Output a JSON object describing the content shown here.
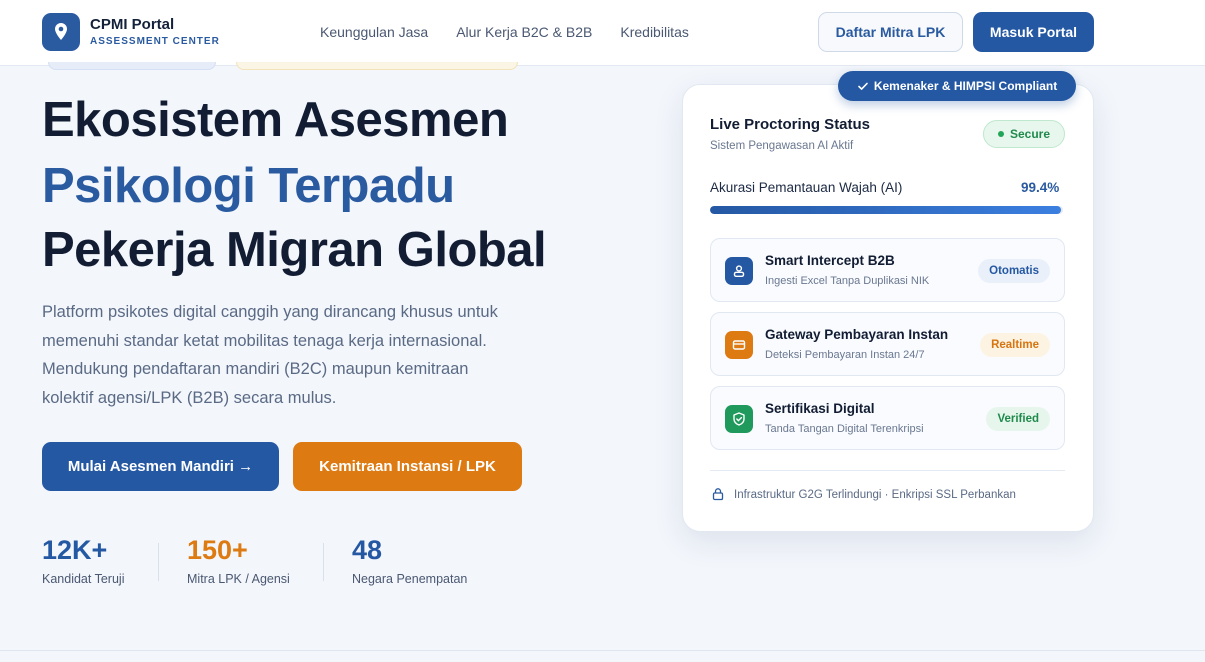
{
  "brand": {
    "title": "CPMI Portal",
    "subtitle": "ASSESSMENT CENTER"
  },
  "nav": {
    "links": [
      "Keunggulan Jasa",
      "Alur Kerja B2C & B2B",
      "Kredibilitas"
    ],
    "register_label": "Daftar Mitra LPK",
    "login_label": "Masuk Portal"
  },
  "hero": {
    "line1": "Ekosistem Asesmen",
    "line2": "Psikologi Terpadu",
    "line3": "Pekerja Migran Global",
    "description": "Platform psikotes digital canggih yang dirancang khusus untuk memenuhi standar ketat mobilitas tenaga kerja internasional. Mendukung pendaftaran mandiri (B2C) maupun kemitraan kolektif agensi/LPK (B2B) secara mulus.",
    "cta_primary": "Mulai Asesmen Mandiri →",
    "cta_secondary": "Kemitraan Instansi / LPK"
  },
  "stats": [
    {
      "value": "12K+",
      "label": "Kandidat Teruji",
      "color": "#2558a3"
    },
    {
      "value": "150+",
      "label": "Mitra LPK / Agensi",
      "color": "#dd7a12"
    },
    {
      "value": "48",
      "label": "Negara Penempatan",
      "color": "#2558a3"
    }
  ],
  "card": {
    "badge": "Kemenaker & HIMPSI Compliant",
    "title": "Live Proctoring Status",
    "subtitle": "Sistem Pengawasan AI Aktif",
    "status": "Secure",
    "accuracy_label": "Akurasi Pemantauan Wajah (AI)",
    "accuracy_value": "99.4%",
    "accuracy_fraction": 0.994,
    "features": [
      {
        "title": "Smart Intercept B2B",
        "subtitle": "Ingesti Excel Tanpa Duplikasi NIK",
        "tag": "Otomatis",
        "icon": "users-icon",
        "color": "#2558a3"
      },
      {
        "title": "Gateway Pembayaran Instan",
        "subtitle": "Deteksi Pembayaran Instan 24/7",
        "tag": "Realtime",
        "icon": "credit-card-icon",
        "color": "#dd7a12"
      },
      {
        "title": "Sertifikasi Digital",
        "subtitle": "Tanda Tangan Digital Terenkripsi",
        "tag": "Verified",
        "icon": "shield-check-icon",
        "color": "#1f9a5c"
      }
    ],
    "footer": "Infrastruktur G2G Terlindungi · Enkripsi SSL Perbankan"
  }
}
